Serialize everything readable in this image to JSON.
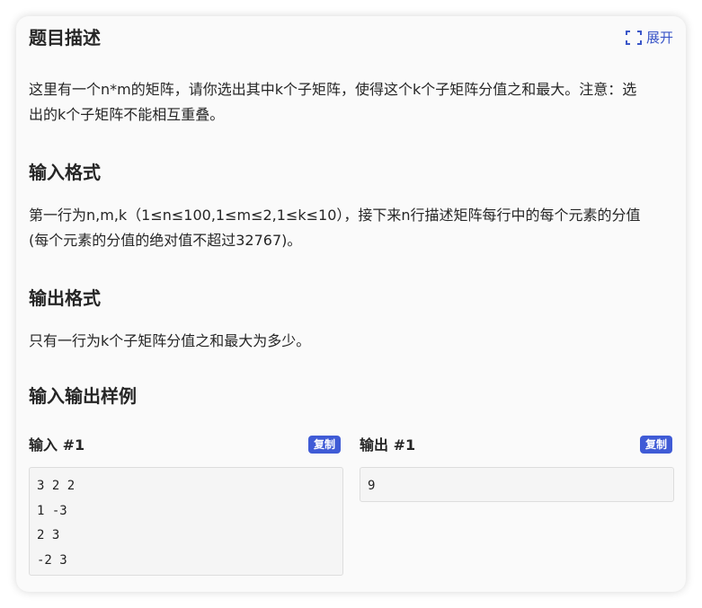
{
  "header": {
    "title": "题目描述",
    "expand_label": "展开"
  },
  "description": {
    "text": "这里有一个n*m的矩阵，请你选出其中k个子矩阵，使得这个k个子矩阵分值之和最大。注意：选出的k个子矩阵不能相互重叠。"
  },
  "input_format": {
    "heading": "输入格式",
    "text": "第一行为n,m,k（1≤n≤100,1≤m≤2,1≤k≤10），接下来n行描述矩阵每行中的每个元素的分值(每个元素的分值的绝对值不超过32767)。"
  },
  "output_format": {
    "heading": "输出格式",
    "text": "只有一行为k个子矩阵分值之和最大为多少。"
  },
  "samples": {
    "heading": "输入输出样例",
    "input": {
      "label": "输入 #1",
      "copy_label": "复制",
      "content": "3 2 2\n1 -3\n2 3\n-2 3"
    },
    "output": {
      "label": "输出 #1",
      "copy_label": "复制",
      "content": "9"
    }
  },
  "icons": {
    "expand": "expand-icon"
  },
  "colors": {
    "accent": "#3f5bd6",
    "link": "#3b57c8"
  }
}
